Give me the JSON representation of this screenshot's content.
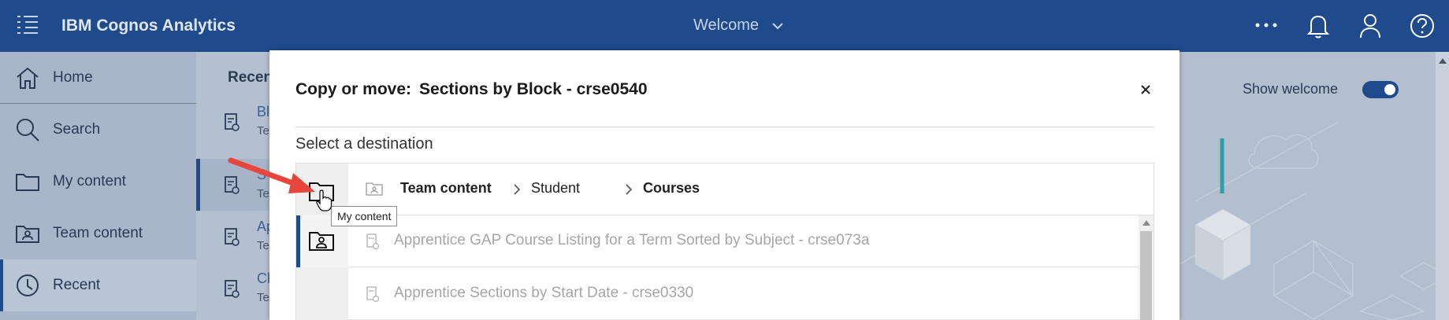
{
  "header": {
    "app_title": "IBM Cognos Analytics",
    "welcome_label": "Welcome",
    "icons": [
      "menu-icon",
      "more-icon",
      "bell-icon",
      "user-icon",
      "help-icon"
    ]
  },
  "sidebar": {
    "items": [
      {
        "label": "Home",
        "icon": "home-icon"
      },
      {
        "label": "Search",
        "icon": "search-icon"
      },
      {
        "label": "My content",
        "icon": "folder-icon"
      },
      {
        "label": "Team content",
        "icon": "team-folder-icon"
      },
      {
        "label": "Recent",
        "icon": "clock-icon"
      }
    ]
  },
  "recent_panel": {
    "header": "Recen",
    "rows": [
      {
        "title": "Bl",
        "sub": "Te"
      },
      {
        "title": "S",
        "sub": "Te"
      },
      {
        "title": "Ap",
        "sub": "Te"
      },
      {
        "title": "Cl",
        "sub": "Te"
      }
    ]
  },
  "welcome_panel": {
    "show_welcome_label": "Show welcome",
    "show_welcome_on": true
  },
  "dialog": {
    "title_prefix": "Copy or move:",
    "title_name": "Sections by Block - crse0540",
    "destination_label": "Select a destination",
    "breadcrumb": [
      "Team content",
      "Student",
      "Courses"
    ],
    "items": [
      "Apprentice GAP Course Listing for a Term Sorted by Subject - crse073a",
      "Apprentice Sections by Start Date - crse0330"
    ],
    "tooltip": "My content"
  },
  "colors": {
    "header_bg": "#1f4b8c",
    "accent": "#1f4b8c",
    "arrow": "#e8463c"
  }
}
